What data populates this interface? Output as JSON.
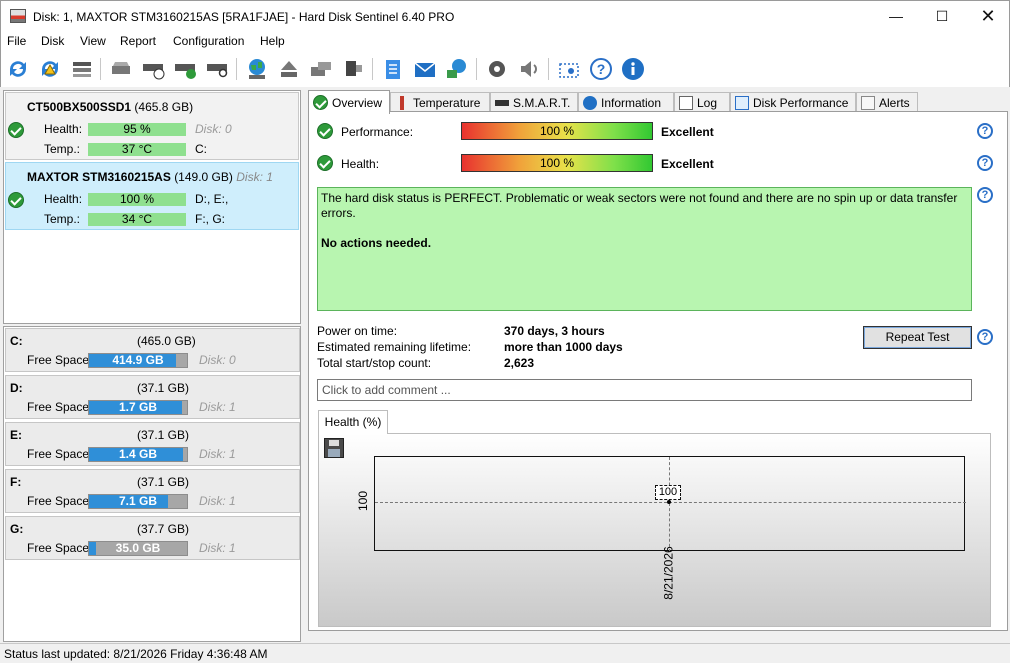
{
  "window": {
    "title": "Disk: 1, MAXTOR STM3160215AS [5RA1FJAE]  -  Hard Disk Sentinel 6.40 PRO"
  },
  "menu": [
    "File",
    "Disk",
    "View",
    "Report",
    "Configuration",
    "Help"
  ],
  "toolbar_icons": [
    "refresh-icon",
    "refresh-alert-icon",
    "disk-details-icon",
    "disk-icon",
    "disk-clock-icon",
    "disk-check-icon",
    "disk-search-icon",
    "globe-icon",
    "eject-icon",
    "disk-transfer-icon",
    "disk-usb-icon",
    "report-icon",
    "mail-icon",
    "network-icon",
    "settings-icon",
    "sound-icon",
    "screenshot-icon",
    "help-icon",
    "info-icon"
  ],
  "disks": [
    {
      "name": "CT500BX500SSD1",
      "size": "(465.8 GB)",
      "extra": "",
      "health_label": "Health:",
      "health": "95 %",
      "temp_label": "Temp.:",
      "temp": "37 °C",
      "disk_no": "Disk: 0",
      "drives": "C:"
    },
    {
      "name": "MAXTOR STM3160215AS",
      "size": "(149.0 GB)",
      "extra": "Disk: 1",
      "health_label": "Health:",
      "health": "100 %",
      "temp_label": "Temp.:",
      "temp": "34 °C",
      "disk_no": "D:, E:,",
      "drives": "F:, G:"
    }
  ],
  "volumes": [
    {
      "letter": "C:",
      "size": "(465.0 GB)",
      "free_label": "Free Space",
      "free": "414.9 GB",
      "free_fraction": 0.89,
      "disk": "Disk: 0"
    },
    {
      "letter": "D:",
      "size": "(37.1 GB)",
      "free_label": "Free Space",
      "free": "1.7 GB",
      "free_fraction": 0.95,
      "disk": "Disk: 1"
    },
    {
      "letter": "E:",
      "size": "(37.1 GB)",
      "free_label": "Free Space",
      "free": "1.4 GB",
      "free_fraction": 0.96,
      "disk": "Disk: 1"
    },
    {
      "letter": "F:",
      "size": "(37.1 GB)",
      "free_label": "Free Space",
      "free": "7.1 GB",
      "free_fraction": 0.81,
      "disk": "Disk: 1"
    },
    {
      "letter": "G:",
      "size": "(37.7 GB)",
      "free_label": "Free Space",
      "free": "35.0 GB",
      "free_fraction": 0.07,
      "disk": "Disk: 1"
    }
  ],
  "tabs": [
    "Overview",
    "Temperature",
    "S.M.A.R.T.",
    "Information",
    "Log",
    "Disk Performance",
    "Alerts"
  ],
  "overview": {
    "performance_label": "Performance:",
    "performance_value": "100 %",
    "performance_rating": "Excellent",
    "health_label": "Health:",
    "health_value": "100 %",
    "health_rating": "Excellent",
    "status_text": "The hard disk status is PERFECT. Problematic or weak sectors were not found and there are no spin up or data transfer errors.",
    "status_action": "No actions needed.",
    "power_on_label": "Power on time:",
    "power_on_value": "370 days, 3 hours",
    "lifetime_label": "Estimated remaining lifetime:",
    "lifetime_value": "more than 1000 days",
    "startstop_label": "Total start/stop count:",
    "startstop_value": "2,623",
    "repeat_test": "Repeat Test",
    "comment_placeholder": "Click to add comment ..."
  },
  "chart_tab": "Health (%)",
  "chart_data": {
    "type": "line",
    "x": [
      "8/21/2026"
    ],
    "series": [
      {
        "values": [
          100
        ]
      }
    ],
    "y_tick": "100",
    "data_label": "100"
  },
  "statusbar": "Status last updated: 8/21/2026 Friday 4:36:48 AM",
  "help_glyph": "?"
}
